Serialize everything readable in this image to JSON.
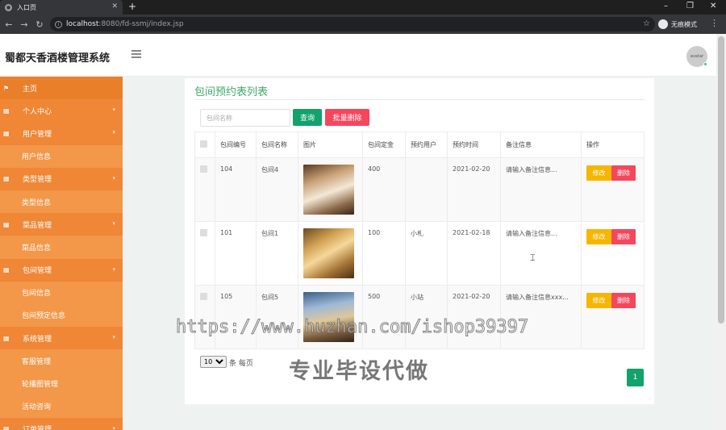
{
  "browser": {
    "tab_title": "入口页",
    "url_host": "localhost",
    "url_rest": ":8080/fd-ssmj/index.jsp",
    "incognito_label": "无痕模式"
  },
  "header": {
    "brand": "蜀都天香酒楼管理系统",
    "avatar_text": "avatar"
  },
  "sidebar": {
    "items": [
      {
        "label": "主页",
        "icon": "flag-icon",
        "type": "home"
      },
      {
        "label": "个人中心",
        "icon": "grid-icon",
        "type": "group"
      },
      {
        "label": "用户管理",
        "icon": "grid-icon",
        "type": "group-open"
      },
      {
        "label": "用户信息",
        "type": "sub"
      },
      {
        "label": "类型管理",
        "icon": "grid-icon",
        "type": "group-open"
      },
      {
        "label": "类型信息",
        "type": "sub"
      },
      {
        "label": "菜品管理",
        "icon": "grid-icon",
        "type": "group-open"
      },
      {
        "label": "菜品信息",
        "type": "sub"
      },
      {
        "label": "包间管理",
        "icon": "grid-icon",
        "type": "group-open"
      },
      {
        "label": "包间信息",
        "type": "sub"
      },
      {
        "label": "包间预定信息",
        "type": "sub"
      },
      {
        "label": "系统管理",
        "icon": "grid-icon",
        "type": "group-open"
      },
      {
        "label": "客服管理",
        "type": "sub"
      },
      {
        "label": "轮播图管理",
        "type": "sub"
      },
      {
        "label": "活动咨询",
        "type": "sub"
      },
      {
        "label": "订单管理",
        "icon": "grid-icon",
        "type": "group"
      }
    ]
  },
  "main": {
    "title": "包间预约表列表",
    "search_placeholder": "包间名称",
    "query_label": "查询",
    "batch_delete_label": "批量删除",
    "columns": [
      "包间编号",
      "包间名称",
      "图片",
      "包间定金",
      "预约用户",
      "预约时间",
      "备注信息",
      "操作"
    ],
    "rows": [
      {
        "no": "104",
        "name": "包间4",
        "deposit": "400",
        "user": "",
        "date": "2021-02-20",
        "note": "请输入备注信息..."
      },
      {
        "no": "101",
        "name": "包间1",
        "deposit": "100",
        "user": "小札",
        "date": "2021-02-18",
        "note": "请输入备注信息..."
      },
      {
        "no": "105",
        "name": "包间5",
        "deposit": "500",
        "user": "小站",
        "date": "2021-02-20",
        "note": "请输入备注信息xxx..."
      }
    ],
    "edit_label": "修改",
    "delete_label": "删除",
    "page_size": "10",
    "page_size_label": "条 每页",
    "current_page": "1"
  },
  "watermark": {
    "url": "https://www.huzhan.com/ishop39397",
    "slogan": "专业毕设代做"
  },
  "colors": {
    "sidebar": "#f0883a",
    "accent_green": "#13a26b",
    "danger": "#f5475c",
    "warning": "#f6b600"
  }
}
